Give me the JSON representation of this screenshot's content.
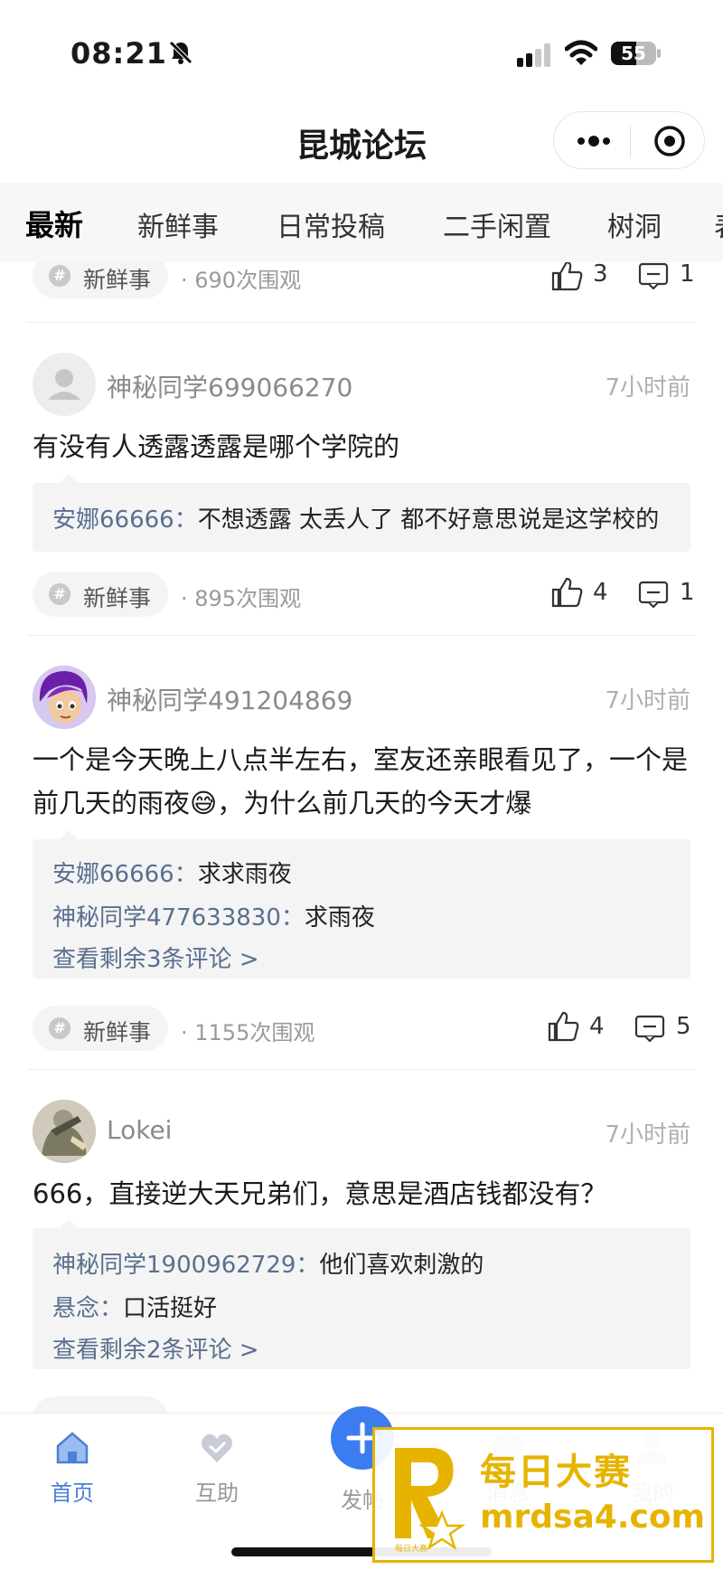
{
  "status": {
    "time": "08:21",
    "battery": "55"
  },
  "header": {
    "title": "昆城论坛"
  },
  "tabs": [
    "最新",
    "新鲜事",
    "日常投稿",
    "二手闲置",
    "树洞",
    "表"
  ],
  "posts": [
    {
      "partial": true,
      "tag": "新鲜事",
      "views": "· 690次围观",
      "likes": "3",
      "comments": "1"
    },
    {
      "username": "神秘同学699066270",
      "time": "7小时前",
      "content": "有没有人透露透露是哪个学院的",
      "comment_list": [
        {
          "user": "安娜66666：",
          "text": "不想透露 太丢人了 都不好意思说是这学校的"
        }
      ],
      "tag": "新鲜事",
      "views": "· 895次围观",
      "likes": "4",
      "comments": "1"
    },
    {
      "username": "神秘同学491204869",
      "time": "7小时前",
      "content_line1": "一个是今天晚上八点半左右，室友还亲眼看见了，一个是",
      "content_line2a": "前几天的雨夜",
      "content_emoji": "😅",
      "content_line2b": "，为什么前几天的今天才爆",
      "comment_list": [
        {
          "user": "安娜66666：",
          "text": "求求雨夜"
        },
        {
          "user": "神秘同学477633830：",
          "text": "求雨夜"
        }
      ],
      "more_comments": "查看剩余3条评论 >",
      "tag": "新鲜事",
      "views": "· 1155次围观",
      "likes": "4",
      "comments": "5"
    },
    {
      "username": "Lokei",
      "time": "7小时前",
      "content": "666，直接逆大天兄弟们，意思是酒店钱都没有？",
      "comment_list": [
        {
          "user": "神秘同学1900962729：",
          "text": "他们喜欢刺激的"
        },
        {
          "user": "悬念：",
          "text": "口活挺好"
        }
      ],
      "more_comments": "查看剩余2条评论 >"
    }
  ],
  "nav": [
    {
      "label": "首页",
      "icon": "home-icon"
    },
    {
      "label": "互助",
      "icon": "help-icon"
    },
    {
      "label": "发帖",
      "icon": "plus-icon"
    },
    {
      "label": "消息",
      "icon": "message-icon"
    },
    {
      "label": "我的",
      "icon": "user-icon"
    }
  ],
  "watermark": {
    "cn": "每日大赛",
    "url": "mrdsa4.com",
    "small": "每日大赛"
  },
  "colors": {
    "accent": "#3b7df0",
    "active_nav": "#4d7fd4",
    "watermark": "#e6b400"
  }
}
